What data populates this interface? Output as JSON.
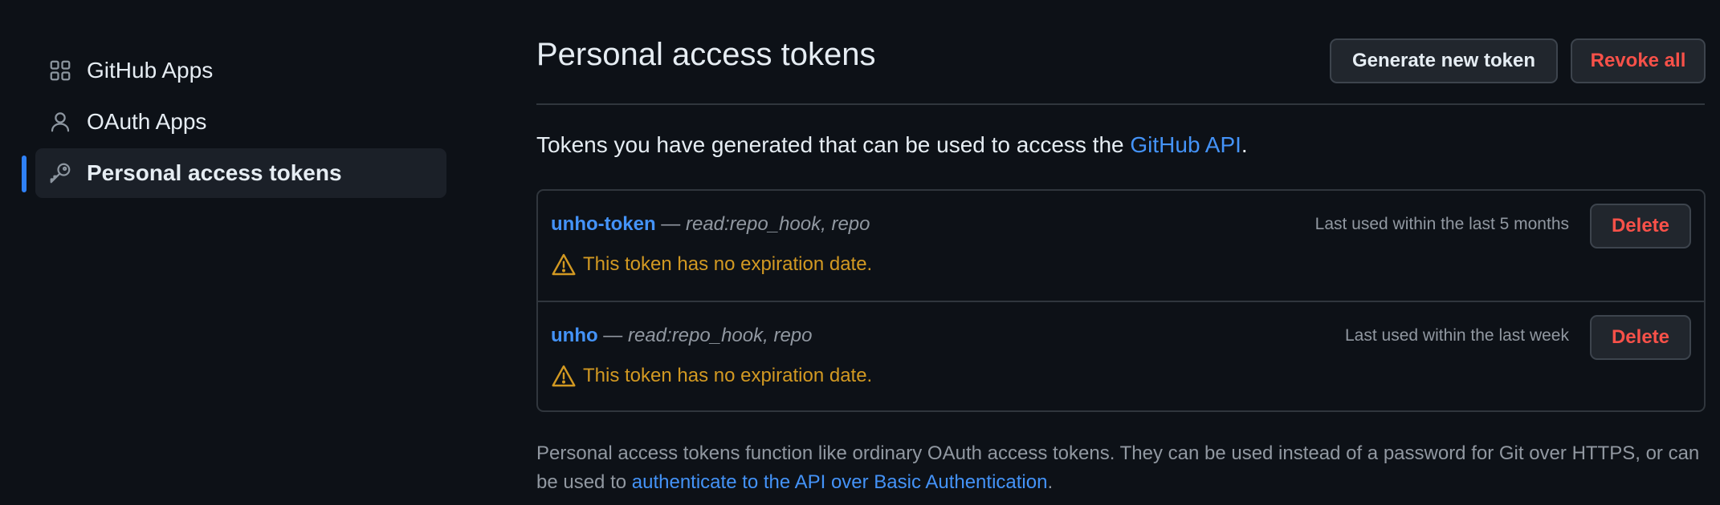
{
  "sidebar": {
    "items": [
      {
        "label": "GitHub Apps",
        "icon": "apps-grid-icon",
        "active": false
      },
      {
        "label": "OAuth Apps",
        "icon": "person-icon",
        "active": false
      },
      {
        "label": "Personal access tokens",
        "icon": "key-icon",
        "active": true
      }
    ]
  },
  "header": {
    "title": "Personal access tokens",
    "generate_label": "Generate new token",
    "revoke_label": "Revoke all"
  },
  "intro": {
    "text": "Tokens you have generated that can be used to access the ",
    "link_text": "GitHub API",
    "suffix": "."
  },
  "tokens": [
    {
      "name": "unho-token",
      "separator": " — ",
      "scopes": "read:repo_hook, repo",
      "warning": "This token has no expiration date.",
      "last_used": "Last used within the last 5 months",
      "delete_label": "Delete"
    },
    {
      "name": "unho",
      "separator": " — ",
      "scopes": "read:repo_hook, repo",
      "warning": "This token has no expiration date.",
      "last_used": "Last used within the last week",
      "delete_label": "Delete"
    }
  ],
  "footer": {
    "text": "Personal access tokens function like ordinary OAuth access tokens. They can be used instead of a password for Git over HTTPS, or can be used to ",
    "link_text": "authenticate to the API over Basic Authentication",
    "suffix": "."
  },
  "colors": {
    "background": "#0d1117",
    "accent": "#2f81f7",
    "link": "#4493f8",
    "danger": "#f85149",
    "warning": "#d29922"
  }
}
